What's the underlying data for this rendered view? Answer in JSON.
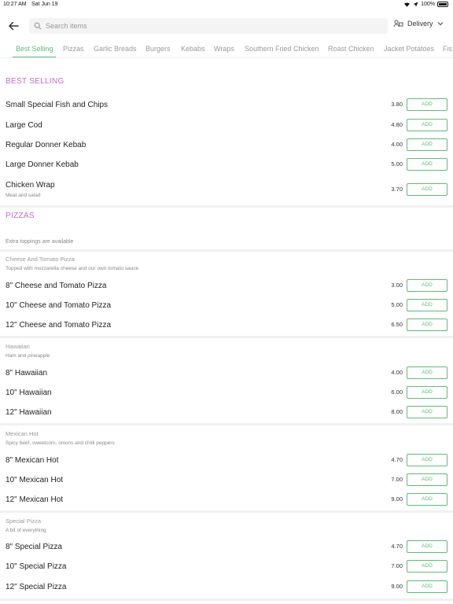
{
  "status": {
    "time": "10:27 AM",
    "date": "Sat Jun 19",
    "battery": "100%"
  },
  "header": {
    "search_placeholder": "Search items",
    "delivery_label": "Delivery"
  },
  "tabs": [
    "Best Selling",
    "Pizzas",
    "Garlic Breads",
    "Burgers",
    "Kebabs",
    "Wraps",
    "Southern Fried Chicken",
    "Roast Chicken",
    "Jacket Potatoes",
    "Fis"
  ],
  "add_label": "ADD",
  "best_selling": {
    "title": "BEST SELLING",
    "items": [
      {
        "name": "Small Special Fish and Chips",
        "price": "3.80"
      },
      {
        "name": "Large Cod",
        "price": "4.80"
      },
      {
        "name": "Regular Donner Kebab",
        "price": "4.00"
      },
      {
        "name": "Large Donner Kebab",
        "price": "5.00"
      },
      {
        "name": "Chicken Wrap",
        "desc": "Meat and salad",
        "price": "3.70"
      }
    ]
  },
  "pizzas": {
    "title": "PIZZAS",
    "note": "Extra toppings are available",
    "groups": [
      {
        "title": "Cheese And Tomato Pizza",
        "desc": "Topped with mozzarella cheese and our own tomato sauce",
        "items": [
          {
            "name": "8\" Cheese and Tomato Pizza",
            "price": "3.00"
          },
          {
            "name": "10\" Cheese and Tomato Pizza",
            "price": "5.00"
          },
          {
            "name": "12\" Cheese and Tomato Pizza",
            "price": "6.50"
          }
        ]
      },
      {
        "title": "Hawaiian",
        "desc": "Ham and pineapple",
        "items": [
          {
            "name": "8\" Hawaiian",
            "price": "4.00"
          },
          {
            "name": "10\" Hawaiian",
            "price": "6.00"
          },
          {
            "name": "12\" Hawaiian",
            "price": "8.00"
          }
        ]
      },
      {
        "title": "Mexican Hot",
        "desc": "Spicy beef, sweetcorn, onions and chilli peppers",
        "items": [
          {
            "name": "8\" Mexican Hot",
            "price": "4.70"
          },
          {
            "name": "10\" Mexican Hot",
            "price": "7.00"
          },
          {
            "name": "12\" Mexican Hot",
            "price": "9.00"
          }
        ]
      },
      {
        "title": "Special Pizza",
        "desc": "A bit of everything",
        "items": [
          {
            "name": "8\" Special Pizza",
            "price": "4.70"
          },
          {
            "name": "10\" Special Pizza",
            "price": "7.00"
          },
          {
            "name": "12\" Special Pizza",
            "price": "9.00"
          }
        ]
      }
    ]
  },
  "colors": {
    "accent": "#62b97a",
    "section_title": "#c06ad1"
  }
}
